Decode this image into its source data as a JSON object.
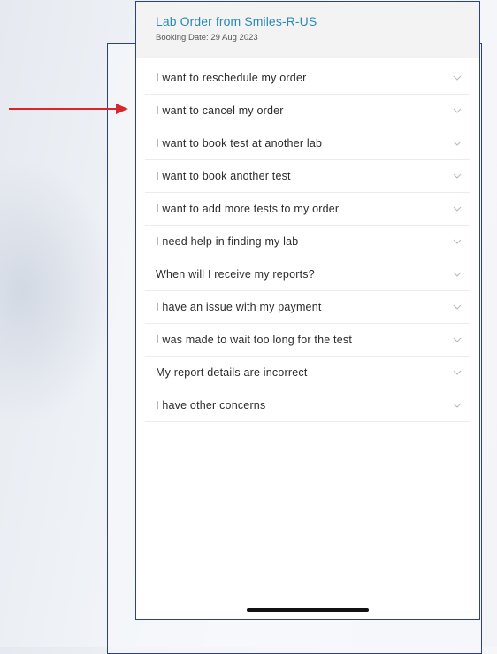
{
  "header": {
    "title": "Lab Order from Smiles-R-US",
    "booking_date": "Booking Date: 29 Aug 2023"
  },
  "items": [
    {
      "label": "I want to reschedule my order",
      "icon": "chevron-down-icon"
    },
    {
      "label": "I want to cancel my order",
      "icon": "chevron-down-icon"
    },
    {
      "label": "I want to book test at another lab",
      "icon": "chevron-down-icon"
    },
    {
      "label": "I want to book another test",
      "icon": "chevron-down-icon"
    },
    {
      "label": "I want to add more tests to my order",
      "icon": "chevron-down-icon"
    },
    {
      "label": "I need help in finding my lab",
      "icon": "chevron-down-icon"
    },
    {
      "label": "When will I receive my reports?",
      "icon": "chevron-down-icon"
    },
    {
      "label": "I have an issue with my payment",
      "icon": "chevron-down-icon"
    },
    {
      "label": "I was made to wait too long for the test",
      "icon": "chevron-down-icon"
    },
    {
      "label": "My report details are incorrect",
      "icon": "chevron-down-icon"
    },
    {
      "label": "I have other concerns",
      "icon": "chevron-down-icon"
    }
  ],
  "colors": {
    "title": "#2a8ab6",
    "frame": "#2f3f8a",
    "annotation_arrow": "#d9262a"
  }
}
